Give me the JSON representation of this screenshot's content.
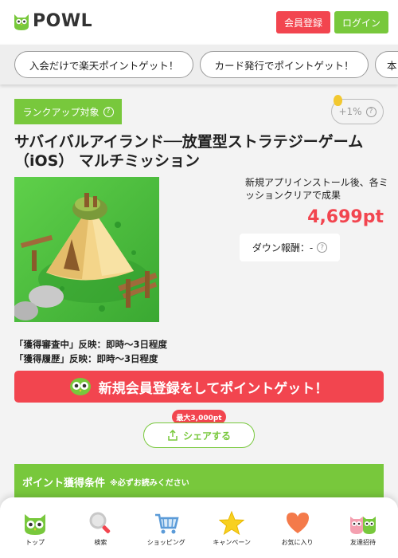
{
  "header": {
    "logo_text": "POWL",
    "register_label": "会員登録",
    "login_label": "ログイン"
  },
  "promo_pills": [
    {
      "label": "入会だけで楽天ポイントゲット！"
    },
    {
      "label": "カード発行でポイントゲット！"
    },
    {
      "label": "本"
    }
  ],
  "offer": {
    "rank_tag": "ランクアップ対象",
    "bonus": "+1%",
    "title": "サバイバルアイランド──放置型ストラテジーゲーム（iOS） マルチミッション",
    "description": "新規アプリインストール後、各ミッションクリアで成果",
    "points": "4,699pt",
    "down_reward": "ダウン報酬：-",
    "note_pending": "「獲得審査中」反映：即時〜3日程度",
    "note_history": "「獲得履歴」反映：即時〜3日程度",
    "signup_cta": "新規会員登録をしてポイントゲット！",
    "share_badge": "最大3,000pt",
    "share_label": "シェアする",
    "conditions_title": "ポイント獲得条件",
    "conditions_note": "※必ずお読みください"
  },
  "colors": {
    "brand_green": "#78c83c",
    "accent_red": "#f2454f"
  },
  "bottom_nav": [
    {
      "label": "トップ",
      "icon": "owl-icon"
    },
    {
      "label": "検索",
      "icon": "search-icon"
    },
    {
      "label": "ショッピング",
      "icon": "cart-icon"
    },
    {
      "label": "キャンペーン",
      "icon": "star-icon"
    },
    {
      "label": "お気に入り",
      "icon": "heart-icon"
    },
    {
      "label": "友達招待",
      "icon": "friends-icon"
    }
  ]
}
